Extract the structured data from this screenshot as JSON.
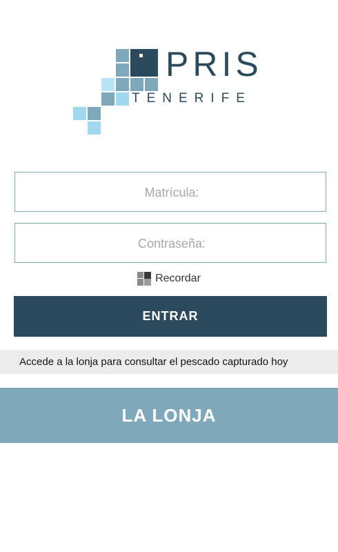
{
  "logo": {
    "brand": "PRIS",
    "sub": "TENERIFE",
    "colors": {
      "dark": "#2c4a5e",
      "mid": "#7fa9ba",
      "light": "#9fd8ef"
    }
  },
  "login": {
    "user_placeholder": "Matrícula:",
    "password_placeholder": "Contraseña:",
    "user_value": "",
    "password_value": "",
    "remember_label": "Recordar",
    "remember_checked": false,
    "submit_label": "ENTRAR"
  },
  "info_text": "Accede a la lonja para consultar el pescado capturado hoy",
  "lonja_label": "LA LONJA"
}
